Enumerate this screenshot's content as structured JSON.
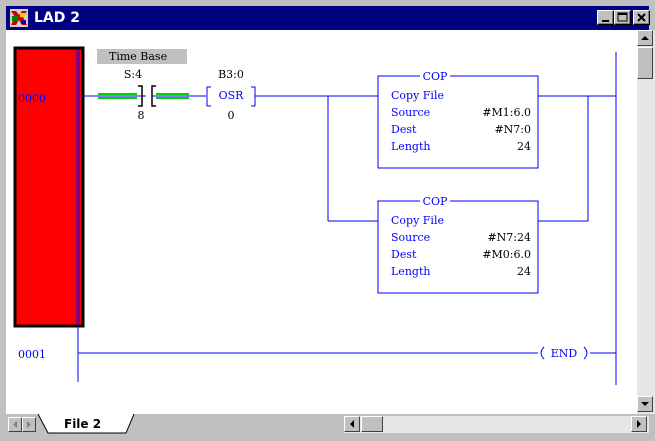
{
  "window": {
    "title": "LAD 2"
  },
  "rungs": [
    {
      "number": "0000"
    },
    {
      "number": "0001"
    }
  ],
  "instructions": {
    "xic": {
      "tooltip": "Time Base",
      "address": "S:4",
      "bit": "8"
    },
    "osr": {
      "address": "B3:0",
      "mnemonic": "OSR",
      "bit": "0"
    },
    "cop1": {
      "mnemonic": "COP",
      "title": "Copy File",
      "source_label": "Source",
      "source_value": "#M1:6.0",
      "dest_label": "Dest",
      "dest_value": "#N7:0",
      "length_label": "Length",
      "length_value": "24"
    },
    "cop2": {
      "mnemonic": "COP",
      "title": "Copy File",
      "source_label": "Source",
      "source_value": "#N7:24",
      "dest_label": "Dest",
      "dest_value": "#M0:6.0",
      "length_label": "Length",
      "length_value": "24"
    },
    "end": {
      "label": "END"
    }
  },
  "tabs": [
    {
      "label": "File 2"
    }
  ],
  "colors": {
    "rail": "#0000ff",
    "fault": "#ff0000",
    "energized": "#00d000",
    "titlebar": "#000080"
  },
  "icons": [
    "app-icon",
    "minimize-icon",
    "maximize-icon",
    "close-icon",
    "scroll-up-icon",
    "scroll-down-icon",
    "first-tab-icon",
    "prev-tab-icon",
    "scroll-left-icon",
    "scroll-right-icon"
  ]
}
